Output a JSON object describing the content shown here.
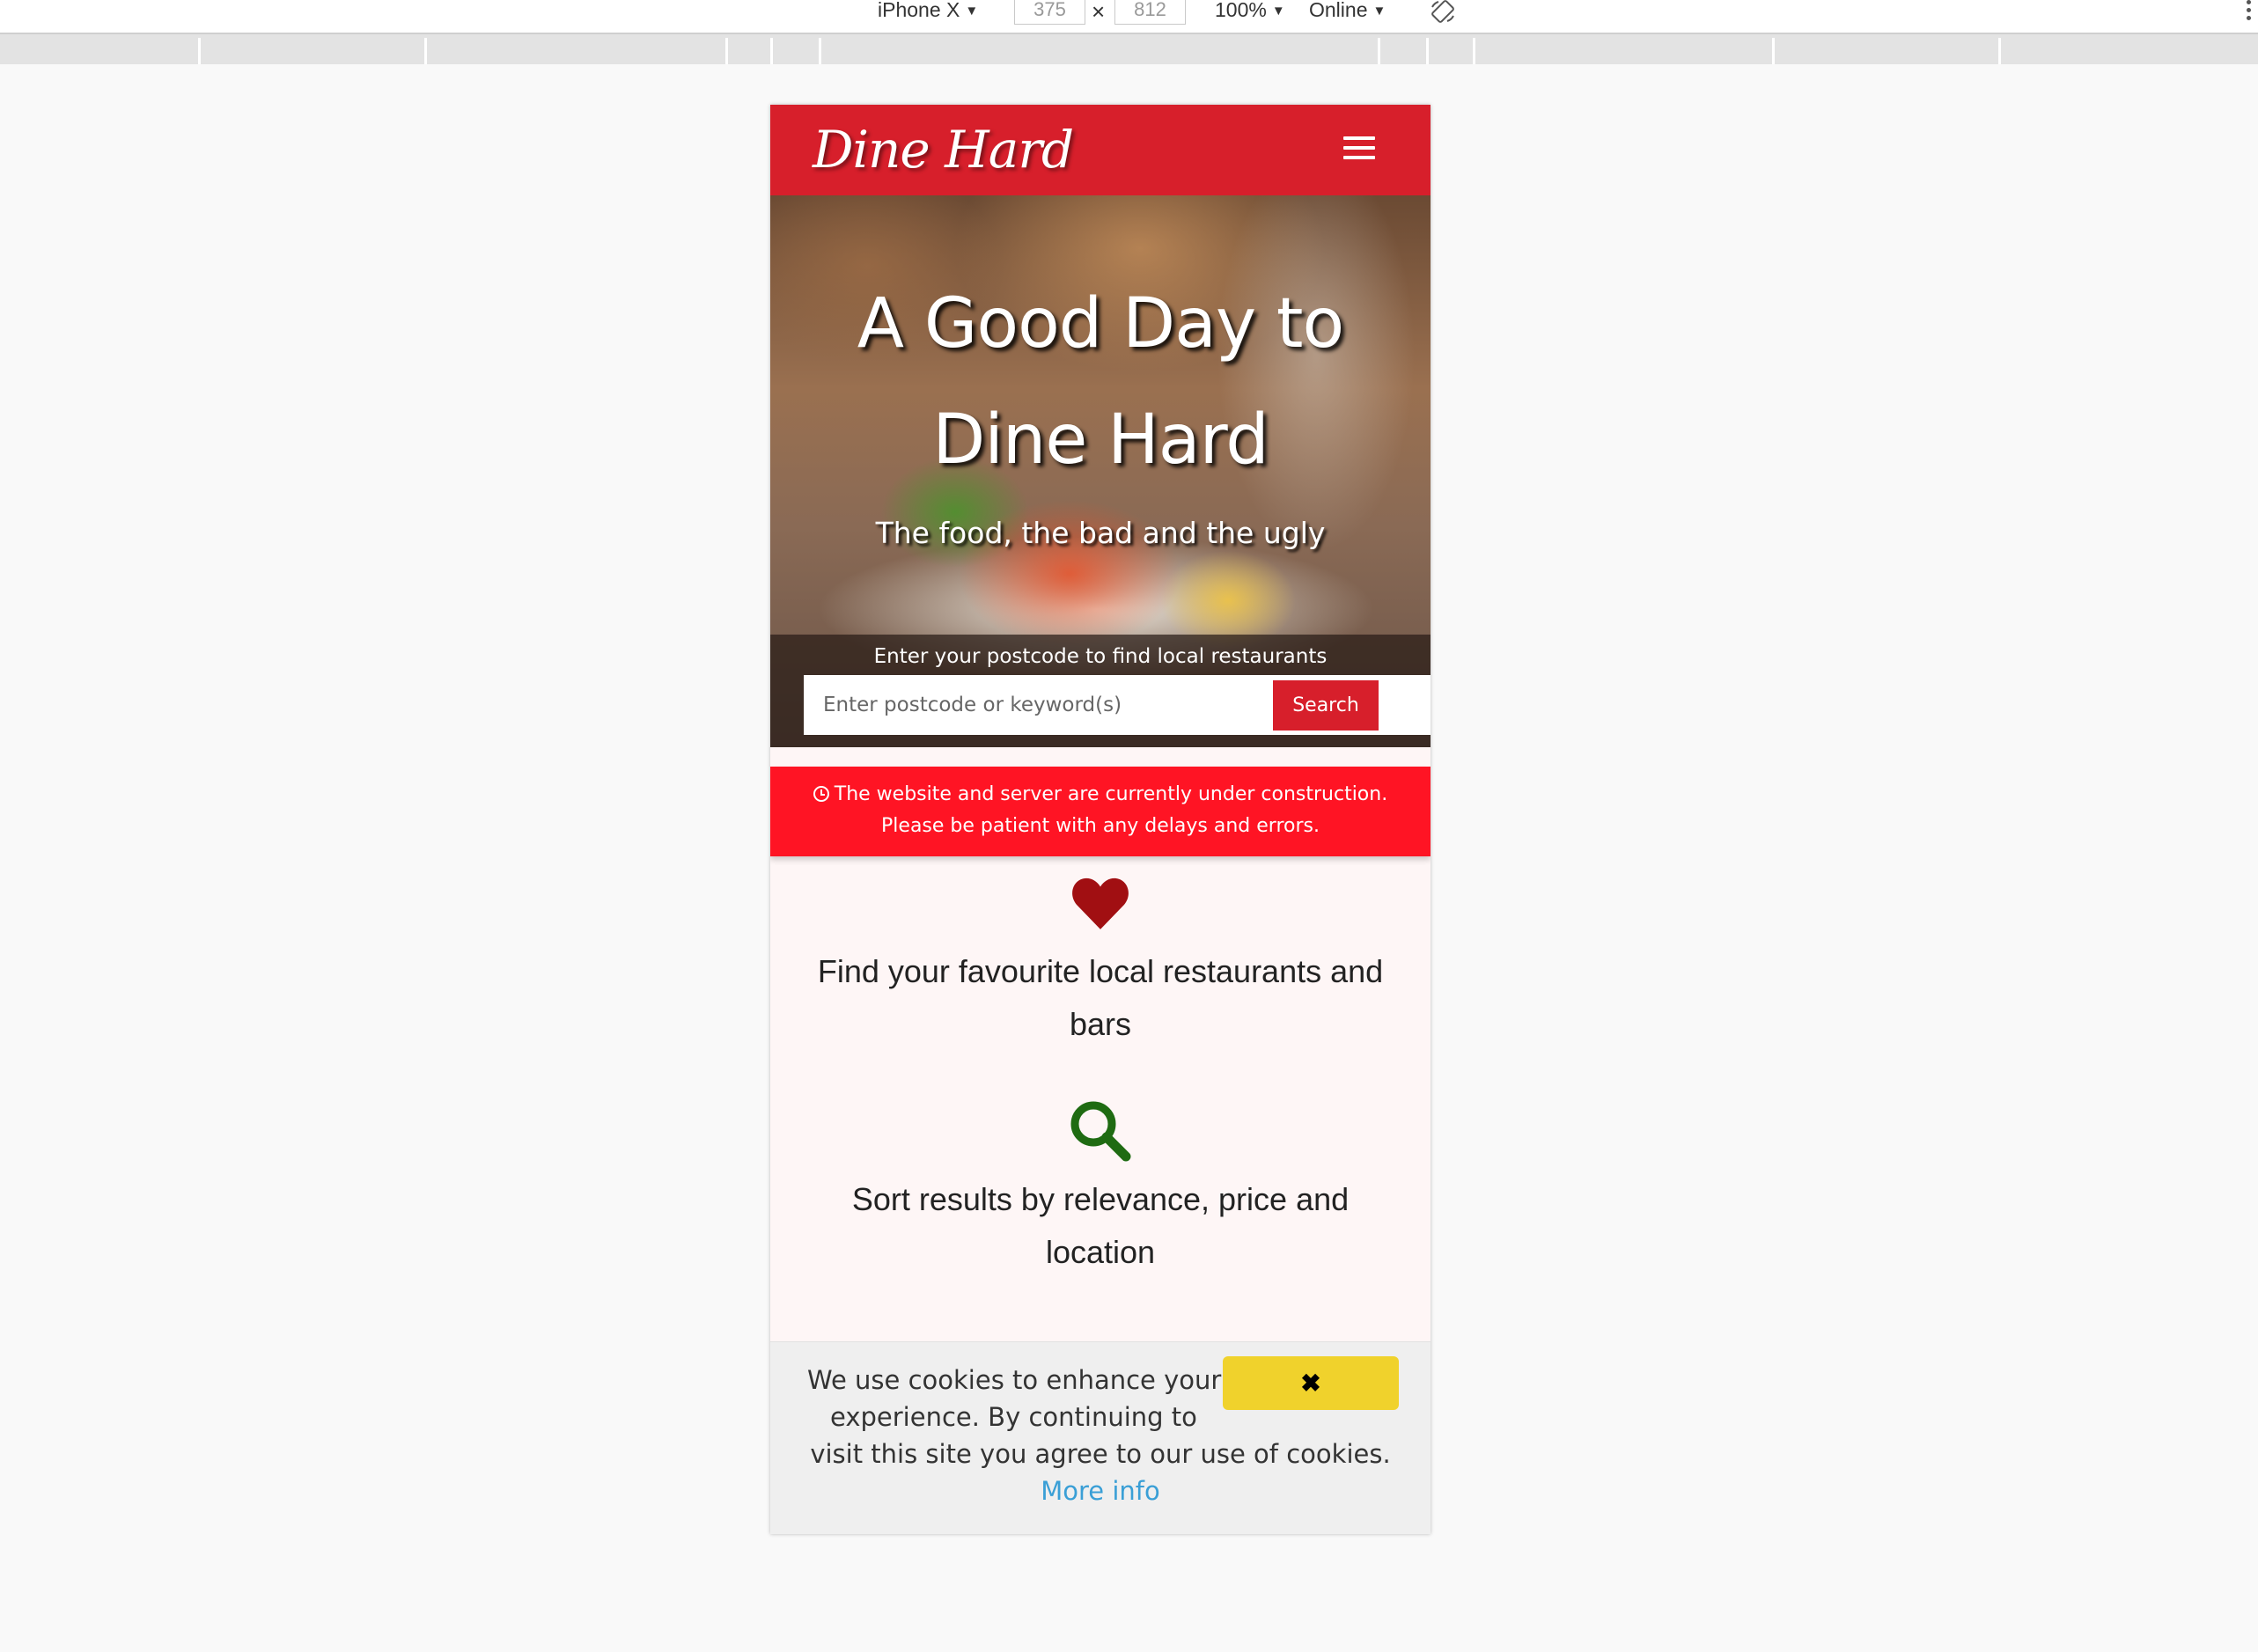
{
  "devtools": {
    "device": "iPhone X",
    "width": "375",
    "height": "812",
    "times": "×",
    "zoom": "100%",
    "network": "Online",
    "caret": "▼"
  },
  "site": {
    "logo": "Dine Hard",
    "brand_color": "#d71f2b"
  },
  "hero": {
    "title": "A Good Day to Dine Hard",
    "subtitle": "The food, the bad and the ugly",
    "search_label": "Enter your postcode to find local restaurants",
    "search_placeholder": "Enter postcode or keyword(s)",
    "search_button": "Search"
  },
  "notice": {
    "line1": "The website and server are currently under construction.",
    "line2": "Please be patient with any delays and errors.",
    "color": "#ff1424"
  },
  "features": [
    {
      "icon": "heart-icon",
      "text": "Find your favourite local restaurants and bars",
      "icon_color": "#a10f12"
    },
    {
      "icon": "search-icon",
      "text": "Sort results by relevance, price and location",
      "icon_color": "#1f6b12"
    }
  ],
  "cookie": {
    "line1": "We use cookies to enhance your",
    "line2": "experience. By continuing to",
    "line3": "visit this site you agree to our use of cookies.",
    "more": "More info",
    "close": "✖",
    "button_color": "#f0d22c"
  }
}
